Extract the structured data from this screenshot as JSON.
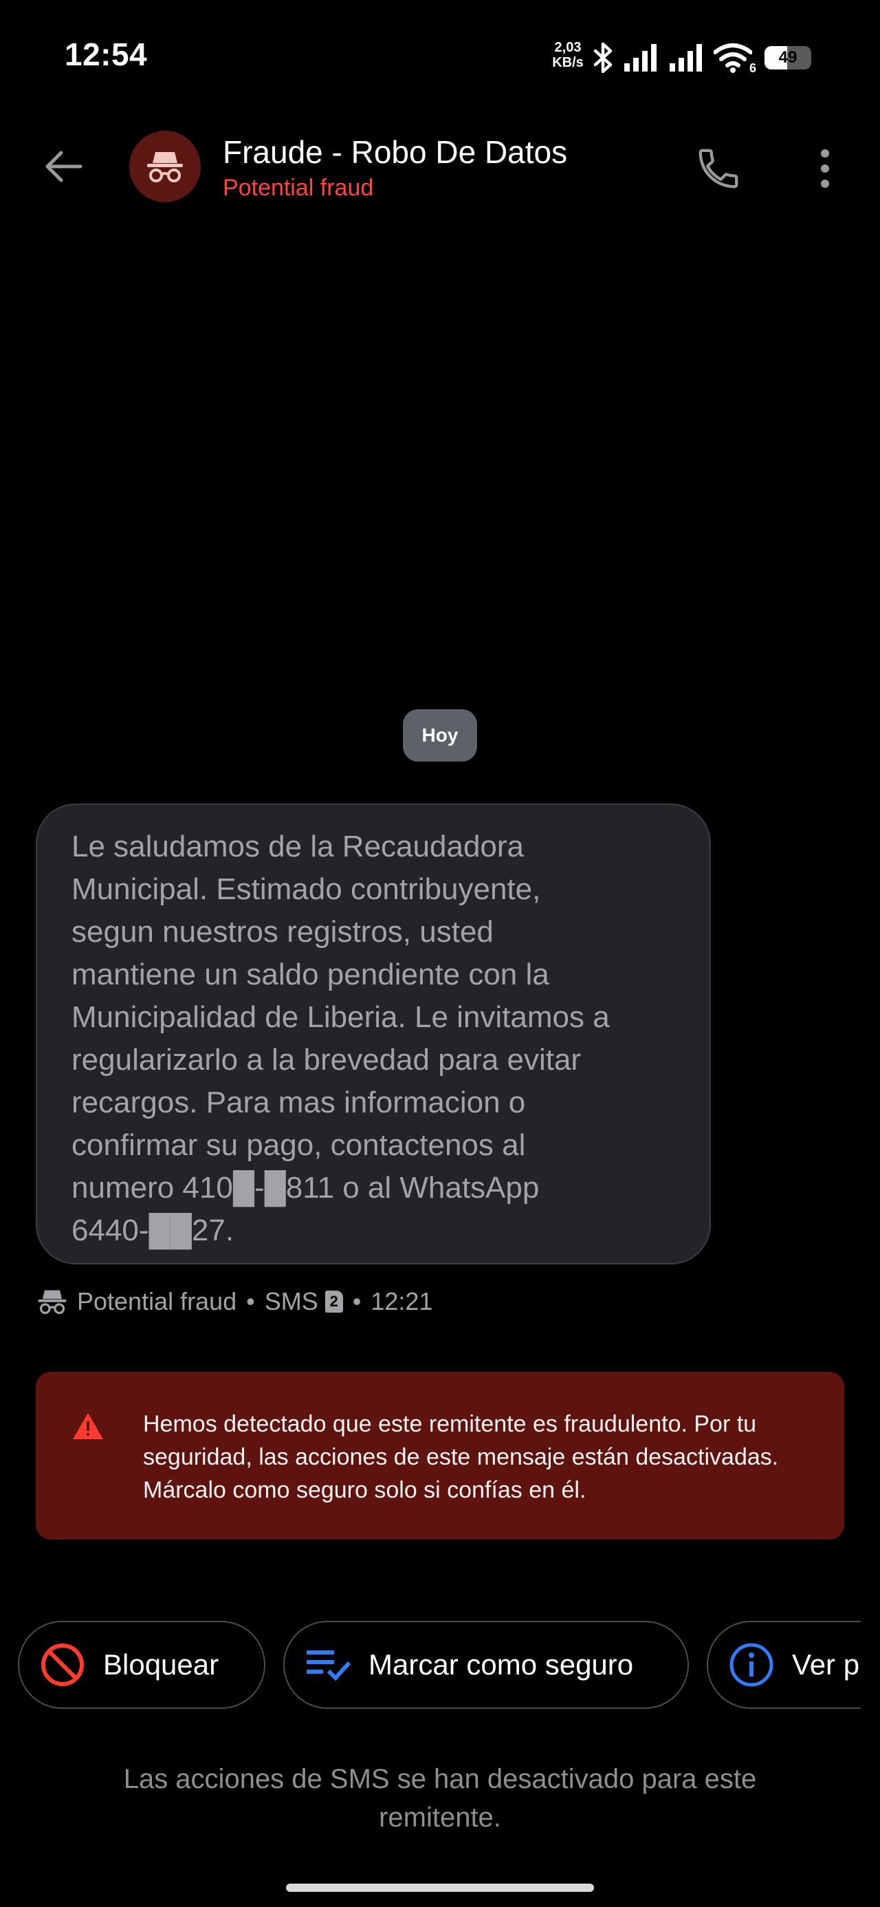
{
  "status_bar": {
    "time": "12:54",
    "net_speed_value": "2,03",
    "net_speed_unit": "KB/s",
    "wifi_sub": "6",
    "battery": "49"
  },
  "header": {
    "contact_name": "Fraude - Robo De Datos",
    "subtitle": "Potential fraud",
    "subtitle_color": "#ff453a"
  },
  "conversation": {
    "date_label": "Hoy",
    "message_lines": [
      "Le saludamos de la Recaudadora",
      "Municipal. Estimado contribuyente,",
      "segun nuestros registros, usted",
      "mantiene un saldo pendiente con la",
      "Municipalidad de Liberia. Le invitamos a",
      "regularizarlo a la brevedad para evitar",
      "recargos. Para mas informacion o",
      "confirmar su pago, contactenos al",
      "numero 410█-█811 o al WhatsApp",
      "6440-██27."
    ],
    "meta": {
      "label": "Potential fraud",
      "separator": "•",
      "channel": "SMS",
      "sim_slot": "2",
      "time": "12:21"
    }
  },
  "warning": {
    "text": "Hemos detectado que este remitente es fraudulento. Por tu seguridad, las acciones de este mensaje están desactivadas. Márcalo como seguro solo si confías en él."
  },
  "actions": {
    "block_label": "Bloquear",
    "mark_safe_label": "Marcar como seguro",
    "view_label": "Ver p"
  },
  "footer": {
    "note": "Las acciones de SMS se han desactivado para este remitente."
  },
  "colors": {
    "background": "#000000",
    "bubble": "#232427",
    "warning_bg": "#5e130e",
    "block_icon": "#ff3b30",
    "accent_blue": "#2f7cf6"
  }
}
